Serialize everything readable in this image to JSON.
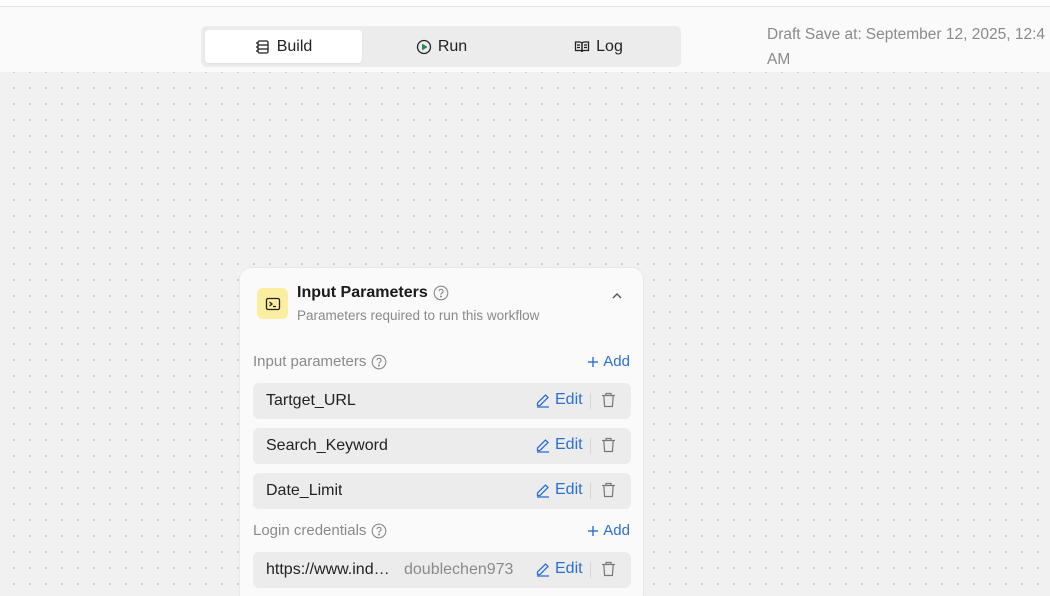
{
  "tabs": [
    {
      "label": "Build",
      "icon": "build-icon",
      "active": true
    },
    {
      "label": "Run",
      "icon": "play-circle-icon",
      "active": false
    },
    {
      "label": "Log",
      "icon": "book-icon",
      "active": false
    }
  ],
  "draft": {
    "label": "Draft Save at:",
    "value": "September 12, 2025, 12:4",
    "suffix": "AM"
  },
  "card": {
    "title": "Input Parameters",
    "subtitle": "Parameters required to run this workflow",
    "icon": "terminal-icon",
    "icon_bg": "#fbeea0"
  },
  "input_section": {
    "label": "Input parameters",
    "add_label": "Add",
    "items": [
      {
        "name": "Tartget_URL",
        "edit_label": "Edit"
      },
      {
        "name": "Search_Keyword",
        "edit_label": "Edit"
      },
      {
        "name": "Date_Limit",
        "edit_label": "Edit"
      }
    ]
  },
  "login_section": {
    "label": "Login credentials",
    "add_label": "Add",
    "items": [
      {
        "url": "https://www.indeed.com",
        "user": "doublechen973",
        "edit_label": "Edit"
      }
    ]
  },
  "colors": {
    "accent": "#2b6fd6",
    "muted": "#8a8a8a",
    "canvas": "#f1f1f1"
  }
}
